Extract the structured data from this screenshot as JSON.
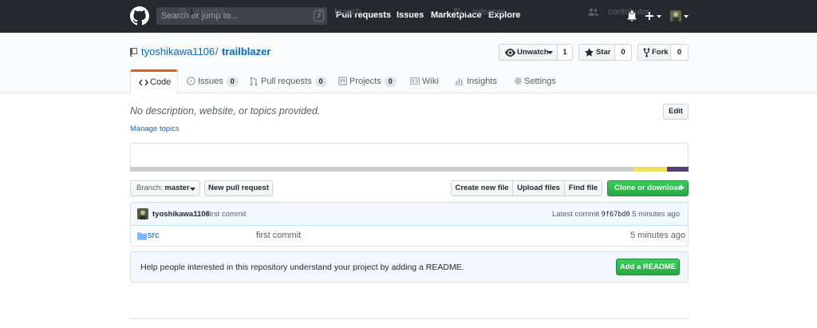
{
  "header": {
    "search_placeholder": "Search or jump to...",
    "slash_key": "/",
    "nav": [
      "Pull requests",
      "Issues",
      "Marketplace",
      "Explore"
    ]
  },
  "repo": {
    "owner": "tyoshikawa1106",
    "separator": "/",
    "name": "trailblazer",
    "watch_label": "Unwatch",
    "watch_count": "1",
    "star_label": "Star",
    "star_count": "0",
    "fork_label": "Fork",
    "fork_count": "0"
  },
  "tabs": [
    {
      "label": "Code",
      "icon": "code-icon",
      "counter": null
    },
    {
      "label": "Issues",
      "icon": "issue-icon",
      "counter": "0"
    },
    {
      "label": "Pull requests",
      "icon": "pull-request-icon",
      "counter": "0"
    },
    {
      "label": "Projects",
      "icon": "project-icon",
      "counter": "0"
    },
    {
      "label": "Wiki",
      "icon": "wiki-icon",
      "counter": null
    },
    {
      "label": "Insights",
      "icon": "graph-icon",
      "counter": null
    },
    {
      "label": "Settings",
      "icon": "gear-icon",
      "counter": null
    }
  ],
  "description": "No description, website, or topics provided.",
  "manage_topics": "Manage topics",
  "edit_label": "Edit",
  "summary": {
    "commits_num": "1",
    "commits_label": "commit",
    "branches_num": "1",
    "branches_label": "branch",
    "releases_num": "0",
    "releases_label": "releases",
    "contributors_num": "1",
    "contributors_label": "contributor"
  },
  "language_colors": [
    "#cccccc",
    "#f1e05a",
    "#563d7c"
  ],
  "file_nav": {
    "branch_prefix": "Branch:",
    "branch_name": "master",
    "new_pr": "New pull request",
    "create_file": "Create new file",
    "upload_files": "Upload files",
    "find_file": "Find file",
    "clone": "Clone or download"
  },
  "commit": {
    "author": "tyoshikawa1106",
    "message": "first commit",
    "latest_label": "Latest commit",
    "sha": "9f67bd0",
    "time": "5 minutes ago"
  },
  "files": [
    {
      "name": "src",
      "message": "first commit",
      "age": "5 minutes ago"
    }
  ],
  "readme": {
    "text": "Help people interested in this repository understand your project by adding a README.",
    "button": "Add a README"
  },
  "colors": {
    "header_bg": "#24292e",
    "link": "#0366d6",
    "tab_accent": "#e36209",
    "green": "#28a745"
  }
}
